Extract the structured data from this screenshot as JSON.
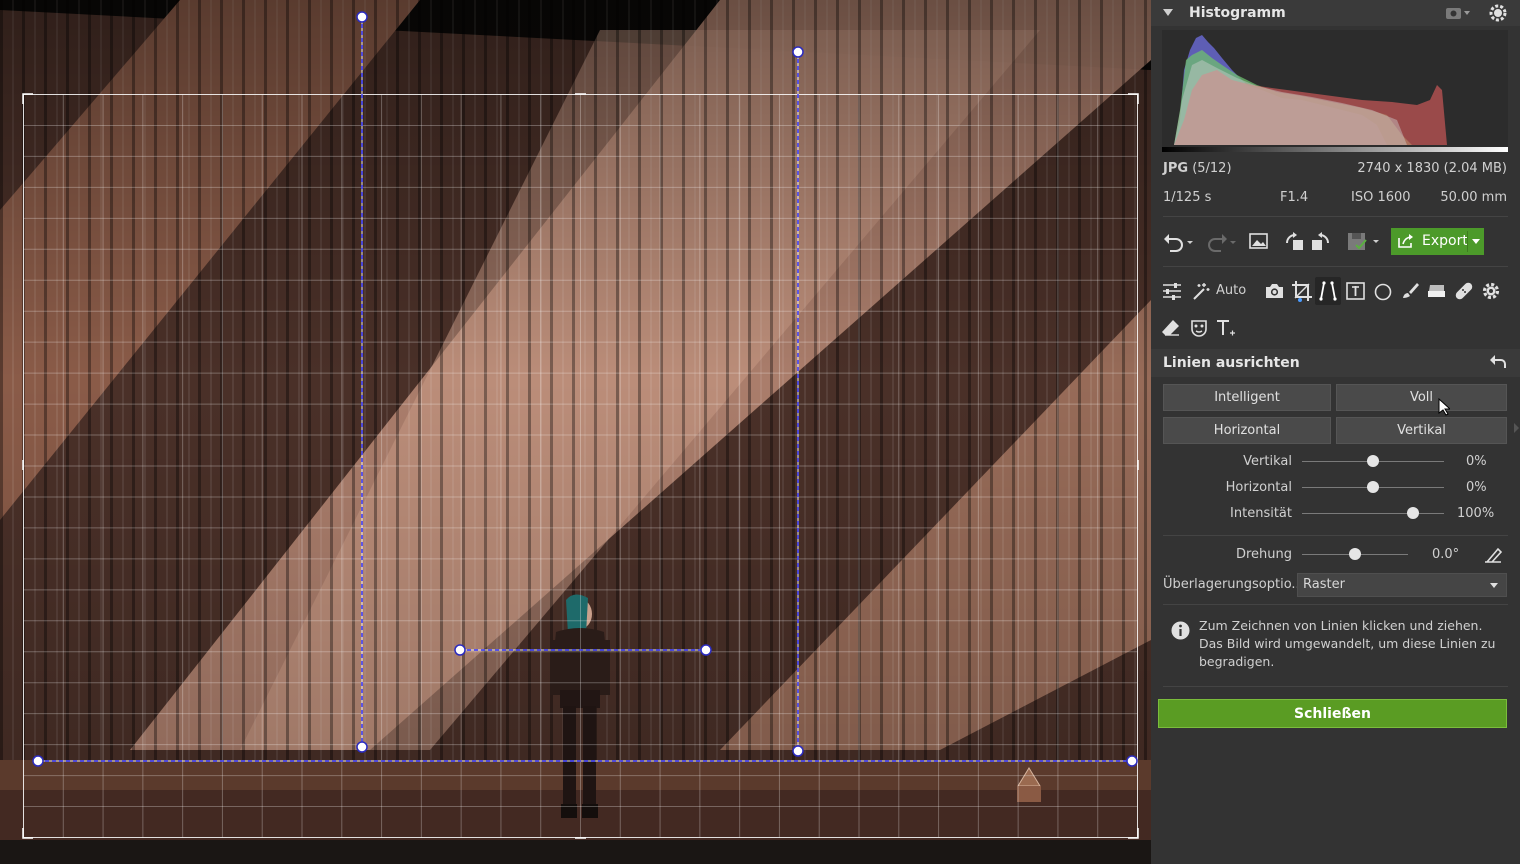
{
  "histogram": {
    "title": "Histogramm"
  },
  "file_info": {
    "format": "JPG",
    "index": "(5/12)",
    "dimensions": "2740 x 1830 (2.04 MB)",
    "shutter": "1/125 s",
    "aperture": "F1.4",
    "iso": "ISO 1600",
    "focal": "50.00 mm"
  },
  "toolbar": {
    "export_label": "Export"
  },
  "tools": {
    "auto_label": "Auto"
  },
  "section": {
    "title": "Linien ausrichten"
  },
  "modes": {
    "intelligent": "Intelligent",
    "voll": "Voll",
    "horizontal": "Horizontal",
    "vertikal": "Vertikal"
  },
  "sliders": [
    {
      "label": "Vertikal",
      "value": "0%",
      "fraction": 0.5
    },
    {
      "label": "Horizontal",
      "value": "0%",
      "fraction": 0.5
    },
    {
      "label": "Intensität",
      "value": "100%",
      "fraction": 0.78
    },
    {
      "label": "Drehung",
      "value": "0.0°",
      "fraction": 0.5
    }
  ],
  "overlay": {
    "label": "Überlagerungsoptio...",
    "selected": "Raster"
  },
  "info": {
    "text": "Zum Zeichnen von Linien klicken und ziehen. Das Bild wird umgewandelt, um diese Linien zu begradigen."
  },
  "close_label": "Schließen",
  "colors": {
    "accent": "#5a9c23",
    "guide": "#3b3bff"
  }
}
